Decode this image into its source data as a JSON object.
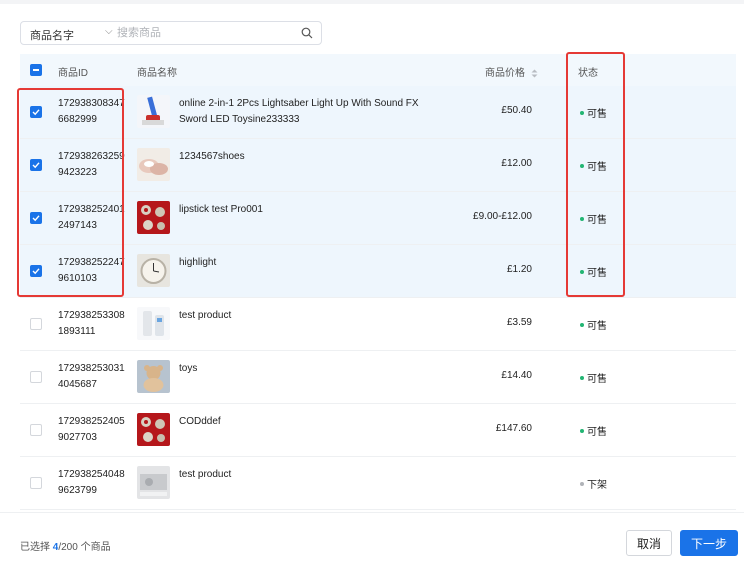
{
  "search": {
    "field_label": "商品名字",
    "placeholder": "搜索商品"
  },
  "table": {
    "headers": {
      "id": "商品ID",
      "name": "商品名称",
      "price": "商品价格",
      "status": "状态"
    },
    "rows": [
      {
        "id": "1729383083476682999",
        "name": "online 2-in-1 2Pcs Lightsaber Light Up With Sound FX Sword LED Toysine233333",
        "price": "£50.40",
        "status": "可售",
        "selected": true,
        "thumb": "lightsaber"
      },
      {
        "id": "1729382632599423223",
        "name": "1234567shoes",
        "price": "£12.00",
        "status": "可售",
        "selected": true,
        "thumb": "shoes"
      },
      {
        "id": "1729382524012497143",
        "name": "lipstick test Pro001",
        "price": "£9.00-£12.00",
        "status": "可售",
        "selected": true,
        "thumb": "lipstick"
      },
      {
        "id": "1729382522479610103",
        "name": "highlight",
        "price": "£1.20",
        "status": "可售",
        "selected": true,
        "thumb": "clock"
      },
      {
        "id": "1729382533081893111",
        "name": "test product",
        "price": "£3.59",
        "status": "可售",
        "selected": false,
        "thumb": "device"
      },
      {
        "id": "1729382530314045687",
        "name": "toys",
        "price": "£14.40",
        "status": "可售",
        "selected": false,
        "thumb": "teddy"
      },
      {
        "id": "1729382524059027703",
        "name": "CODddef",
        "price": "£147.60",
        "status": "可售",
        "selected": false,
        "thumb": "lipstick"
      },
      {
        "id": "1729382540489623799",
        "name": "test product",
        "price": "",
        "status": "下架",
        "selected": false,
        "thumb": "gray"
      }
    ]
  },
  "footer": {
    "selected_prefix": "已选择 ",
    "selected_count": "4",
    "selected_suffix": "/200 个商品",
    "cancel_label": "取消",
    "next_label": "下一步"
  },
  "colors": {
    "accent": "#1a73e8",
    "available_dot": "#22b573",
    "offshelf_dot": "#b0b3b8",
    "highlight_box": "#e53935"
  }
}
